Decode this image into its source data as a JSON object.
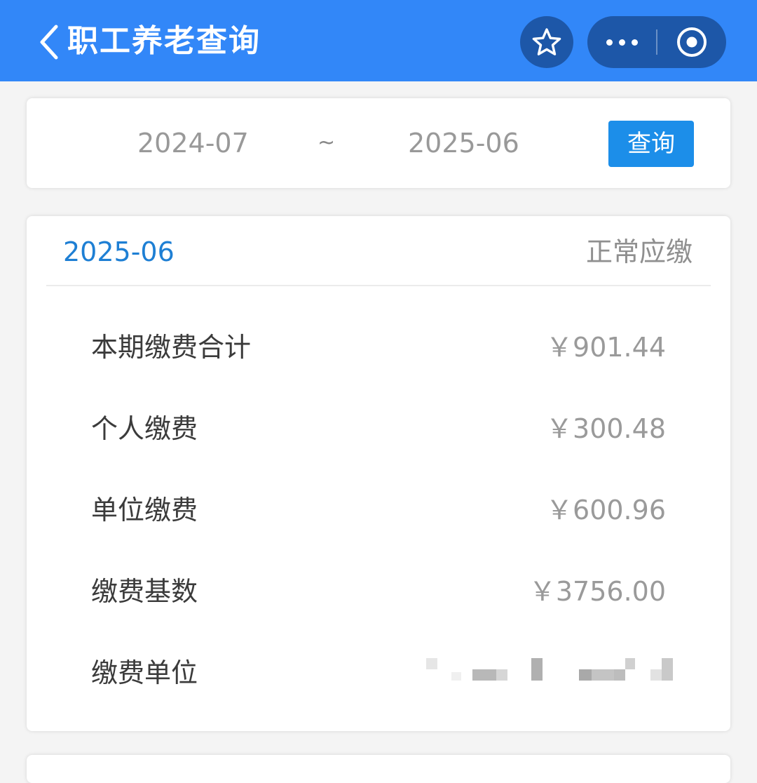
{
  "header": {
    "title": "职工养老查询",
    "back_icon": "chevron-left-icon",
    "favorite_icon": "star-icon",
    "more_icon": "more-dots-icon",
    "close_icon": "target-close-icon",
    "bar_color": "#3287f8"
  },
  "query": {
    "date_from": "2024-07",
    "separator": "~",
    "date_to": "2025-06",
    "button_label": "查询",
    "button_color": "#1c8ee9"
  },
  "record": {
    "period": "2025-06",
    "status": "正常应缴",
    "period_color": "#1e7fd4",
    "rows": [
      {
        "label": "本期缴费合计",
        "value": "￥901.44"
      },
      {
        "label": "个人缴费",
        "value": "￥300.48"
      },
      {
        "label": "单位缴费",
        "value": "￥600.96"
      },
      {
        "label": "缴费基数",
        "value": "￥3756.00"
      },
      {
        "label": "缴费单位",
        "value": ""
      }
    ]
  }
}
